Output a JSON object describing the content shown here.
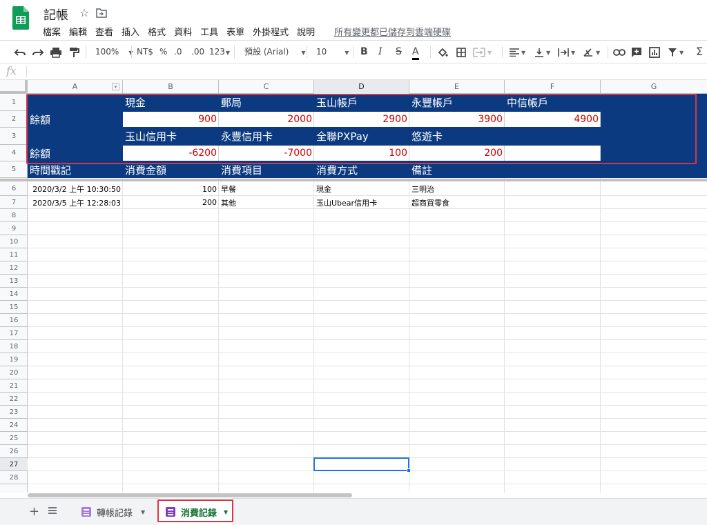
{
  "app": {
    "doc_title": "記帳",
    "menu": [
      "檔案",
      "編輯",
      "查看",
      "插入",
      "格式",
      "資料",
      "工具",
      "表單",
      "外掛程式",
      "說明"
    ],
    "save_status": "所有變更都已儲存到雲端硬碟",
    "brand_color": "#0f9d58"
  },
  "toolbar": {
    "zoom": "100%",
    "currency": "NT$",
    "percent": "%",
    "decrease_decimal": ".0",
    "increase_decimal": ".00",
    "more_formats": "123",
    "font": "預設 (Arial)",
    "font_size": "10",
    "bold": "B",
    "italic": "I",
    "strikethrough": "S",
    "text_color": "A"
  },
  "formula_bar": {
    "icon": "fx",
    "value": ""
  },
  "columns": [
    "A",
    "B",
    "C",
    "D",
    "E",
    "F",
    "G"
  ],
  "selected_column": "D",
  "rows": [
    "1",
    "2",
    "3",
    "4",
    "5",
    "6",
    "7",
    "8",
    "9",
    "10",
    "11",
    "12",
    "13",
    "14",
    "15",
    "16",
    "17",
    "18",
    "19",
    "20",
    "21",
    "22",
    "23",
    "24",
    "25",
    "26",
    "27",
    "28"
  ],
  "selected_row": "27",
  "summary": {
    "band_color": "#0b3a80",
    "value_color": "#cc0000",
    "row1_headers": [
      "現金",
      "郵局",
      "玉山帳戶",
      "永豐帳戶",
      "中信帳戶"
    ],
    "row2_label": "餘額",
    "row2_values": [
      "900",
      "2000",
      "2900",
      "3900",
      "4900"
    ],
    "row3_headers": [
      "玉山信用卡",
      "永豐信用卡",
      "全聯PXPay",
      "悠遊卡"
    ],
    "row4_label": "餘額",
    "row4_values": [
      "-6200",
      "-7000",
      "100",
      "200"
    ],
    "row5_headers": [
      "時間戳記",
      "消費金額",
      "消費項目",
      "消費方式",
      "備註"
    ]
  },
  "records": [
    {
      "timestamp": "2020/3/2 上午 10:30:50",
      "amount": "100",
      "item": "早餐",
      "method": "現金",
      "note": "三明治"
    },
    {
      "timestamp": "2020/3/5 上午 12:28:03",
      "amount": "200",
      "item": "其他",
      "method": "玉山Ubear信用卡",
      "note": "超商買零食"
    }
  ],
  "sheets": {
    "tab1": "轉帳記錄",
    "tab2": "消費記錄",
    "active": "消費記錄"
  }
}
